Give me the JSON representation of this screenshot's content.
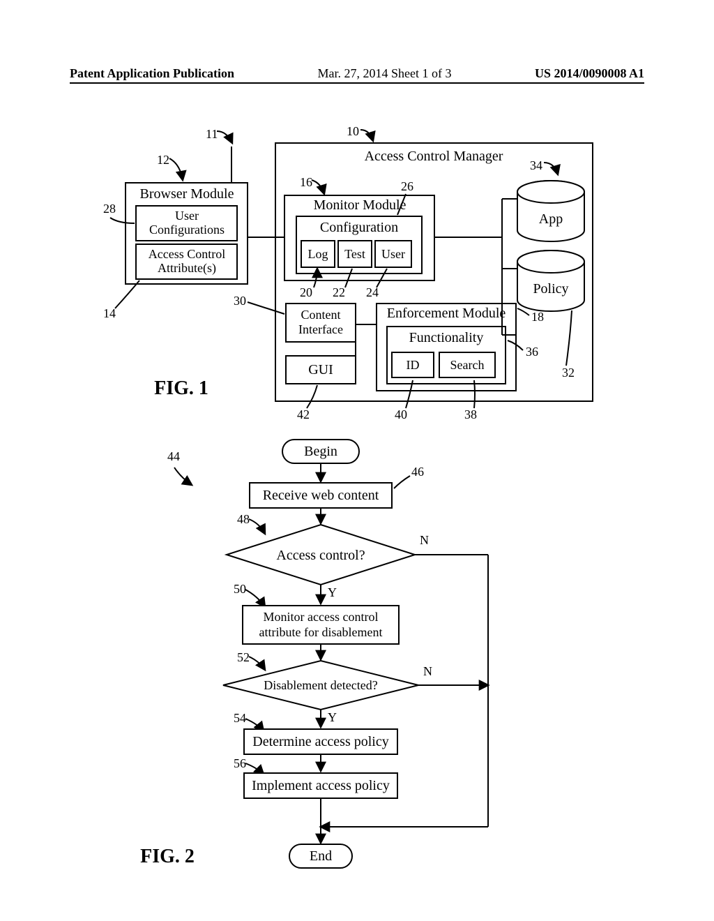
{
  "header": {
    "left": "Patent Application Publication",
    "center": "Mar. 27, 2014  Sheet 1 of 3",
    "right": "US 2014/0090008 A1"
  },
  "fig1": {
    "title": "Access Control Manager",
    "browser": {
      "title": "Browser Module",
      "user_config": "User\nConfigurations",
      "access_attr": "Access Control\nAttribute(s)"
    },
    "monitor": {
      "title": "Monitor Module",
      "config": "Configuration",
      "log": "Log",
      "test": "Test",
      "user": "User"
    },
    "content_if": "Content\nInterface",
    "gui": "GUI",
    "enforcement": {
      "title": "Enforcement Module",
      "functionality": "Functionality",
      "id": "ID",
      "search": "Search"
    },
    "app_db": "App",
    "policy_db": "Policy",
    "caption": "FIG. 1",
    "refs": {
      "r10": "10",
      "r11": "11",
      "r12": "12",
      "r14": "14",
      "r16": "16",
      "r18": "18",
      "r20": "20",
      "r22": "22",
      "r24": "24",
      "r26": "26",
      "r28": "28",
      "r30": "30",
      "r32": "32",
      "r34": "34",
      "r36": "36",
      "r38": "38",
      "r40": "40",
      "r42": "42"
    }
  },
  "fig2": {
    "begin": "Begin",
    "step46": "Receive web content",
    "dec48": "Access control?",
    "step50": "Monitor  access control\nattribute for disablement",
    "dec52": "Disablement detected?",
    "step54": "Determine access policy",
    "step56": "Implement access policy",
    "end": "End",
    "yes": "Y",
    "no": "N",
    "caption": "FIG. 2",
    "refs": {
      "r44": "44",
      "r46": "46",
      "r48": "48",
      "r50": "50",
      "r52": "52",
      "r54": "54",
      "r56": "56"
    }
  }
}
